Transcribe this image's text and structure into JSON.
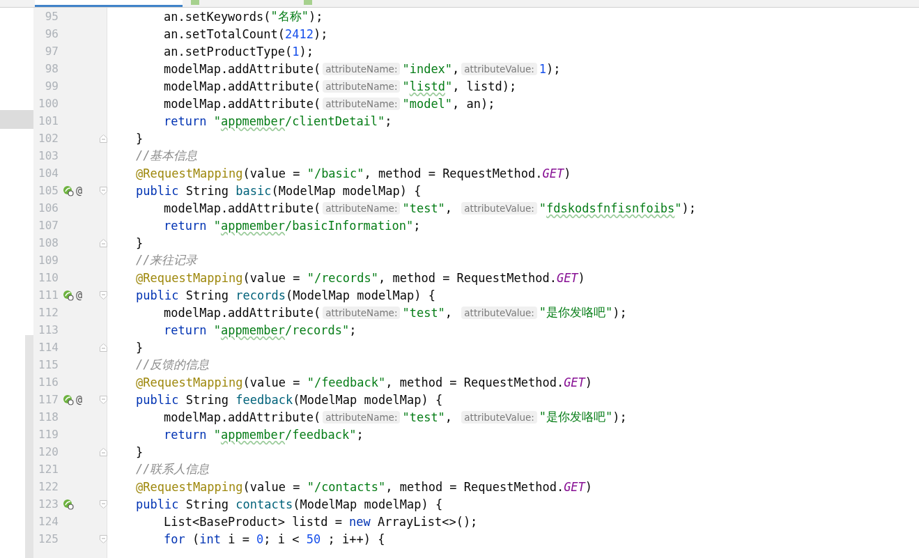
{
  "lines": [
    {
      "number": "95",
      "kind": "statement",
      "run_icon": false,
      "fold_start": false,
      "fold_end": false,
      "segments": [
        {
          "kind": "plain",
          "text": "an.setKeywords("
        },
        {
          "kind": "string",
          "text": "\"名称\""
        },
        {
          "kind": "plain",
          "text": ");"
        }
      ]
    },
    {
      "number": "96",
      "kind": "statement",
      "run_icon": false,
      "fold_start": false,
      "fold_end": false,
      "segments": [
        {
          "kind": "plain",
          "text": "an.setTotalCount("
        },
        {
          "kind": "number",
          "text": "2412"
        },
        {
          "kind": "plain",
          "text": ");"
        }
      ]
    },
    {
      "number": "97",
      "kind": "statement",
      "run_icon": false,
      "fold_start": false,
      "fold_end": false,
      "segments": [
        {
          "kind": "plain",
          "text": "an.setProductType("
        },
        {
          "kind": "number",
          "text": "1"
        },
        {
          "kind": "plain",
          "text": ");"
        }
      ]
    },
    {
      "number": "98",
      "kind": "statement",
      "run_icon": false,
      "fold_start": false,
      "fold_end": false,
      "segments": [
        {
          "kind": "plain",
          "text": "modelMap.addAttribute("
        },
        {
          "kind": "hint",
          "text": "attributeName:"
        },
        {
          "kind": "string",
          "text": "\"index\""
        },
        {
          "kind": "plain",
          "text": ","
        },
        {
          "kind": "hint",
          "text": "attributeValue:"
        },
        {
          "kind": "number",
          "text": "1"
        },
        {
          "kind": "plain",
          "text": ");"
        }
      ]
    },
    {
      "number": "99",
      "kind": "statement",
      "run_icon": false,
      "fold_start": false,
      "fold_end": false,
      "segments": [
        {
          "kind": "plain",
          "text": "modelMap.addAttribute("
        },
        {
          "kind": "hint",
          "text": "attributeName:"
        },
        {
          "kind": "string",
          "text": "\""
        },
        {
          "kind": "flagged",
          "text": "listd"
        },
        {
          "kind": "string",
          "text": "\""
        },
        {
          "kind": "plain",
          "text": ", listd);"
        }
      ]
    },
    {
      "number": "100",
      "kind": "statement",
      "run_icon": false,
      "fold_start": false,
      "fold_end": false,
      "segments": [
        {
          "kind": "plain",
          "text": "modelMap.addAttribute("
        },
        {
          "kind": "hint",
          "text": "attributeName:"
        },
        {
          "kind": "string",
          "text": "\"model\""
        },
        {
          "kind": "plain",
          "text": ", an);"
        }
      ]
    },
    {
      "number": "101",
      "kind": "statement",
      "run_icon": false,
      "fold_start": false,
      "fold_end": false,
      "segments": [
        {
          "kind": "keyword",
          "text": "return "
        },
        {
          "kind": "string",
          "text": "\""
        },
        {
          "kind": "flagged",
          "text": "appmember"
        },
        {
          "kind": "string",
          "text": "/clientDetail\""
        },
        {
          "kind": "plain",
          "text": ";"
        }
      ]
    },
    {
      "number": "102",
      "kind": "member",
      "run_icon": false,
      "fold_start": false,
      "fold_end": true,
      "segments": [
        {
          "kind": "plain",
          "text": "}"
        }
      ]
    },
    {
      "number": "103",
      "kind": "member",
      "run_icon": false,
      "fold_start": false,
      "fold_end": false,
      "segments": [
        {
          "kind": "comment",
          "text": "//基本信息"
        }
      ]
    },
    {
      "number": "104",
      "kind": "member",
      "run_icon": false,
      "fold_start": false,
      "fold_end": false,
      "segments": [
        {
          "kind": "annotation",
          "text": "@RequestMapping"
        },
        {
          "kind": "plain",
          "text": "(value = "
        },
        {
          "kind": "string",
          "text": "\"/basic\""
        },
        {
          "kind": "plain",
          "text": ", method = RequestMethod."
        },
        {
          "kind": "constant",
          "text": "GET"
        },
        {
          "kind": "plain",
          "text": ")"
        }
      ]
    },
    {
      "number": "105",
      "kind": "member",
      "run_icon": true,
      "marker": "@",
      "fold_start": true,
      "fold_end": false,
      "segments": [
        {
          "kind": "keyword",
          "text": "public "
        },
        {
          "kind": "plain",
          "text": "String "
        },
        {
          "kind": "method",
          "text": "basic"
        },
        {
          "kind": "plain",
          "text": "(ModelMap modelMap) {"
        }
      ]
    },
    {
      "number": "106",
      "kind": "statement",
      "run_icon": false,
      "fold_start": false,
      "fold_end": false,
      "segments": [
        {
          "kind": "plain",
          "text": "modelMap.addAttribute("
        },
        {
          "kind": "hint",
          "text": "attributeName:"
        },
        {
          "kind": "string",
          "text": "\"test\""
        },
        {
          "kind": "plain",
          "text": ", "
        },
        {
          "kind": "hint",
          "text": "attributeValue:"
        },
        {
          "kind": "string",
          "text": "\""
        },
        {
          "kind": "flagged",
          "text": "fdskodsfnfisnfoibs"
        },
        {
          "kind": "string",
          "text": "\""
        },
        {
          "kind": "plain",
          "text": ");"
        }
      ]
    },
    {
      "number": "107",
      "kind": "statement",
      "run_icon": false,
      "fold_start": false,
      "fold_end": false,
      "segments": [
        {
          "kind": "keyword",
          "text": "return "
        },
        {
          "kind": "string",
          "text": "\""
        },
        {
          "kind": "flagged",
          "text": "appmember"
        },
        {
          "kind": "string",
          "text": "/basicInformation\""
        },
        {
          "kind": "plain",
          "text": ";"
        }
      ]
    },
    {
      "number": "108",
      "kind": "member",
      "run_icon": false,
      "fold_start": false,
      "fold_end": true,
      "segments": [
        {
          "kind": "plain",
          "text": "}"
        }
      ]
    },
    {
      "number": "109",
      "kind": "member",
      "run_icon": false,
      "fold_start": false,
      "fold_end": false,
      "segments": [
        {
          "kind": "comment",
          "text": "//来往记录"
        }
      ]
    },
    {
      "number": "110",
      "kind": "member",
      "run_icon": false,
      "fold_start": false,
      "fold_end": false,
      "segments": [
        {
          "kind": "annotation",
          "text": "@RequestMapping"
        },
        {
          "kind": "plain",
          "text": "(value = "
        },
        {
          "kind": "string",
          "text": "\"/records\""
        },
        {
          "kind": "plain",
          "text": ", method = RequestMethod."
        },
        {
          "kind": "constant",
          "text": "GET"
        },
        {
          "kind": "plain",
          "text": ")"
        }
      ]
    },
    {
      "number": "111",
      "kind": "member",
      "run_icon": true,
      "marker": "@",
      "fold_start": true,
      "fold_end": false,
      "segments": [
        {
          "kind": "keyword",
          "text": "public "
        },
        {
          "kind": "plain",
          "text": "String "
        },
        {
          "kind": "method",
          "text": "records"
        },
        {
          "kind": "plain",
          "text": "(ModelMap modelMap) {"
        }
      ]
    },
    {
      "number": "112",
      "kind": "statement",
      "run_icon": false,
      "fold_start": false,
      "fold_end": false,
      "segments": [
        {
          "kind": "plain",
          "text": "modelMap.addAttribute("
        },
        {
          "kind": "hint",
          "text": "attributeName:"
        },
        {
          "kind": "string",
          "text": "\"test\""
        },
        {
          "kind": "plain",
          "text": ", "
        },
        {
          "kind": "hint",
          "text": "attributeValue:"
        },
        {
          "kind": "string",
          "text": "\"是你发咯吧\""
        },
        {
          "kind": "plain",
          "text": ");"
        }
      ]
    },
    {
      "number": "113",
      "kind": "statement",
      "run_icon": false,
      "fold_start": false,
      "fold_end": false,
      "segments": [
        {
          "kind": "keyword",
          "text": "return "
        },
        {
          "kind": "string",
          "text": "\""
        },
        {
          "kind": "flagged",
          "text": "appmember"
        },
        {
          "kind": "string",
          "text": "/records\""
        },
        {
          "kind": "plain",
          "text": ";"
        }
      ]
    },
    {
      "number": "114",
      "kind": "member",
      "run_icon": false,
      "fold_start": false,
      "fold_end": true,
      "segments": [
        {
          "kind": "plain",
          "text": "}"
        }
      ]
    },
    {
      "number": "115",
      "kind": "member",
      "run_icon": false,
      "fold_start": false,
      "fold_end": false,
      "segments": [
        {
          "kind": "comment",
          "text": "//反馈的信息"
        }
      ]
    },
    {
      "number": "116",
      "kind": "member",
      "run_icon": false,
      "fold_start": false,
      "fold_end": false,
      "segments": [
        {
          "kind": "annotation",
          "text": "@RequestMapping"
        },
        {
          "kind": "plain",
          "text": "(value = "
        },
        {
          "kind": "string",
          "text": "\"/feedback\""
        },
        {
          "kind": "plain",
          "text": ", method = RequestMethod."
        },
        {
          "kind": "constant",
          "text": "GET"
        },
        {
          "kind": "plain",
          "text": ")"
        }
      ]
    },
    {
      "number": "117",
      "kind": "member",
      "run_icon": true,
      "marker": "@",
      "fold_start": true,
      "fold_end": false,
      "segments": [
        {
          "kind": "keyword",
          "text": "public "
        },
        {
          "kind": "plain",
          "text": "String "
        },
        {
          "kind": "method",
          "text": "feedback"
        },
        {
          "kind": "plain",
          "text": "(ModelMap modelMap) {"
        }
      ]
    },
    {
      "number": "118",
      "kind": "statement",
      "run_icon": false,
      "fold_start": false,
      "fold_end": false,
      "segments": [
        {
          "kind": "plain",
          "text": "modelMap.addAttribute("
        },
        {
          "kind": "hint",
          "text": "attributeName:"
        },
        {
          "kind": "string",
          "text": "\"test\""
        },
        {
          "kind": "plain",
          "text": ", "
        },
        {
          "kind": "hint",
          "text": "attributeValue:"
        },
        {
          "kind": "string",
          "text": "\"是你发咯吧\""
        },
        {
          "kind": "plain",
          "text": ");"
        }
      ]
    },
    {
      "number": "119",
      "kind": "statement",
      "run_icon": false,
      "fold_start": false,
      "fold_end": false,
      "segments": [
        {
          "kind": "keyword",
          "text": "return "
        },
        {
          "kind": "string",
          "text": "\""
        },
        {
          "kind": "flagged",
          "text": "appmember"
        },
        {
          "kind": "string",
          "text": "/feedback\""
        },
        {
          "kind": "plain",
          "text": ";"
        }
      ]
    },
    {
      "number": "120",
      "kind": "member",
      "run_icon": false,
      "fold_start": false,
      "fold_end": true,
      "segments": [
        {
          "kind": "plain",
          "text": "}"
        }
      ]
    },
    {
      "number": "121",
      "kind": "member",
      "run_icon": false,
      "fold_start": false,
      "fold_end": false,
      "segments": [
        {
          "kind": "comment",
          "text": "//联系人信息"
        }
      ]
    },
    {
      "number": "122",
      "kind": "member",
      "run_icon": false,
      "fold_start": false,
      "fold_end": false,
      "segments": [
        {
          "kind": "annotation",
          "text": "@RequestMapping"
        },
        {
          "kind": "plain",
          "text": "(value = "
        },
        {
          "kind": "string",
          "text": "\"/contacts\""
        },
        {
          "kind": "plain",
          "text": ", method = RequestMethod."
        },
        {
          "kind": "constant",
          "text": "GET"
        },
        {
          "kind": "plain",
          "text": ")"
        }
      ]
    },
    {
      "number": "123",
      "kind": "member",
      "run_icon": true,
      "fold_start": true,
      "fold_end": false,
      "segments": [
        {
          "kind": "keyword",
          "text": "public "
        },
        {
          "kind": "plain",
          "text": "String "
        },
        {
          "kind": "method",
          "text": "contacts"
        },
        {
          "kind": "plain",
          "text": "(ModelMap modelMap) {"
        }
      ]
    },
    {
      "number": "124",
      "kind": "statement",
      "run_icon": false,
      "fold_start": false,
      "fold_end": false,
      "segments": [
        {
          "kind": "plain",
          "text": "List<BaseProduct> listd = "
        },
        {
          "kind": "keyword",
          "text": "new "
        },
        {
          "kind": "plain",
          "text": "ArrayList<>();"
        }
      ]
    },
    {
      "number": "125",
      "kind": "statement",
      "run_icon": false,
      "fold_start": true,
      "fold_end": false,
      "segments": [
        {
          "kind": "keyword",
          "text": "for "
        },
        {
          "kind": "plain",
          "text": "("
        },
        {
          "kind": "keyword",
          "text": "int "
        },
        {
          "kind": "plain",
          "text": "i = "
        },
        {
          "kind": "number",
          "text": "0"
        },
        {
          "kind": "plain",
          "text": "; i < "
        },
        {
          "kind": "number",
          "text": "50"
        },
        {
          "kind": "plain",
          "text": " ; i++) {"
        }
      ]
    }
  ]
}
